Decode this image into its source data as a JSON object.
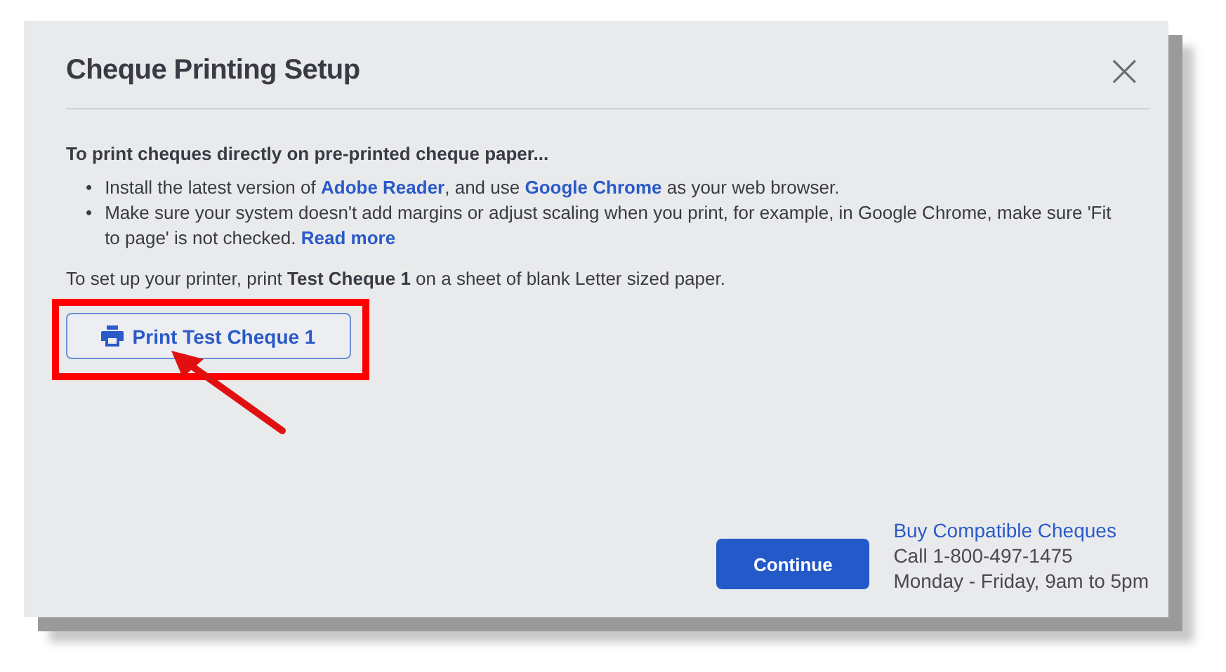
{
  "dialog": {
    "title": "Cheque Printing Setup",
    "close": "×",
    "intro": "To print cheques directly on pre-printed cheque paper...",
    "bullets": [
      {
        "marker": "•",
        "parts": [
          {
            "kind": "text",
            "text": "Install the latest version of "
          },
          {
            "kind": "link",
            "text": "Adobe Reader"
          },
          {
            "kind": "text",
            "text": ", and use "
          },
          {
            "kind": "link",
            "text": "Google Chrome"
          },
          {
            "kind": "text",
            "text": " as your web browser."
          }
        ]
      },
      {
        "marker": "•",
        "parts": [
          {
            "kind": "text",
            "text": "Make sure your system doesn't add margins or adjust scaling when you print, for example, in Google Chrome, make sure 'Fit to page' is not checked. "
          },
          {
            "kind": "link",
            "text": "Read more"
          }
        ]
      }
    ],
    "setup_text": "To set up your printer, print **Test Cheque 1** on a sheet of blank Letter sized paper.",
    "print_button": {
      "label": "Print Test Cheque 1",
      "highlighted": true
    },
    "continue_button": "Continue",
    "footer": {
      "link": "Buy Compatible Cheques",
      "phone": "Call 1-800-497-1475",
      "hours": "Monday - Friday, 9am to 5pm"
    }
  }
}
